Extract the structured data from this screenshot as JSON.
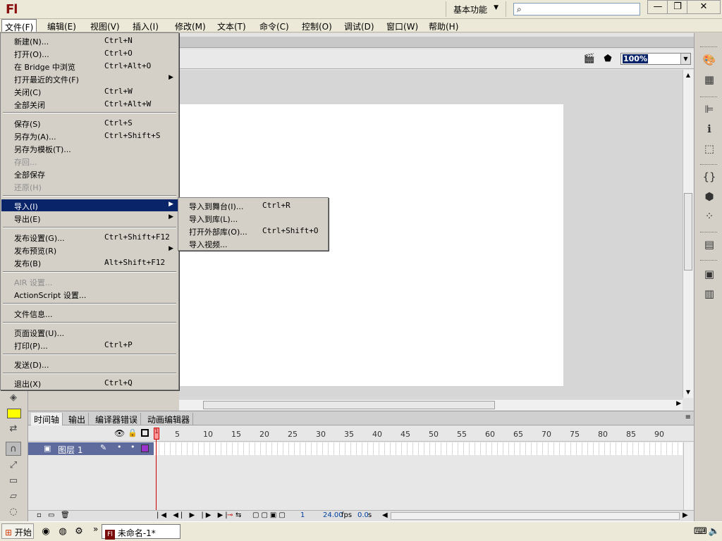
{
  "app": {
    "logo": "Fl",
    "workspace_label": "基本功能",
    "search_placeholder": "",
    "window_buttons": {
      "minimize": "—",
      "restore": "❐",
      "close": "✕"
    }
  },
  "menubar": {
    "items": [
      "文件(F)",
      "编辑(E)",
      "视图(V)",
      "插入(I)",
      "修改(M)",
      "文本(T)",
      "命令(C)",
      "控制(O)",
      "调试(D)",
      "窗口(W)",
      "帮助(H)"
    ]
  },
  "file_menu": {
    "items": [
      {
        "label": "新建(N)...",
        "shortcut": "Ctrl+N"
      },
      {
        "label": "打开(O)...",
        "shortcut": "Ctrl+O"
      },
      {
        "label": "在 Bridge 中浏览",
        "shortcut": "Ctrl+Alt+O"
      },
      {
        "label": "打开最近的文件(F)",
        "shortcut": ""
      },
      {
        "label": "关闭(C)",
        "shortcut": "Ctrl+W"
      },
      {
        "label": "全部关闭",
        "shortcut": "Ctrl+Alt+W"
      },
      {
        "label": "保存(S)",
        "shortcut": "Ctrl+S"
      },
      {
        "label": "另存为(A)...",
        "shortcut": "Ctrl+Shift+S"
      },
      {
        "label": "另存为模板(T)...",
        "shortcut": ""
      },
      {
        "label": "存回...",
        "shortcut": ""
      },
      {
        "label": "全部保存",
        "shortcut": ""
      },
      {
        "label": "还原(H)",
        "shortcut": ""
      },
      {
        "label": "导入(I)",
        "shortcut": ""
      },
      {
        "label": "导出(E)",
        "shortcut": ""
      },
      {
        "label": "发布设置(G)...",
        "shortcut": "Ctrl+Shift+F12"
      },
      {
        "label": "发布预览(R)",
        "shortcut": ""
      },
      {
        "label": "发布(B)",
        "shortcut": "Alt+Shift+F12"
      },
      {
        "label": "AIR 设置...",
        "shortcut": ""
      },
      {
        "label": "ActionScript 设置...",
        "shortcut": ""
      },
      {
        "label": "文件信息...",
        "shortcut": ""
      },
      {
        "label": "页面设置(U)...",
        "shortcut": ""
      },
      {
        "label": "打印(P)...",
        "shortcut": "Ctrl+P"
      },
      {
        "label": "发送(D)...",
        "shortcut": ""
      },
      {
        "label": "退出(X)",
        "shortcut": "Ctrl+Q"
      }
    ]
  },
  "import_submenu": {
    "items": [
      {
        "label": "导入到舞台(I)...",
        "shortcut": "Ctrl+R"
      },
      {
        "label": "导入到库(L)...",
        "shortcut": ""
      },
      {
        "label": "打开外部库(O)...",
        "shortcut": "Ctrl+Shift+O"
      },
      {
        "label": "导入视频...",
        "shortcut": ""
      }
    ]
  },
  "edit_bar": {
    "zoom": "100%"
  },
  "timeline": {
    "tabs": [
      "时间轴",
      "输出",
      "编译器错误",
      "动画编辑器"
    ],
    "frame_numbers": [
      "1",
      "5",
      "10",
      "15",
      "20",
      "25",
      "30",
      "35",
      "40",
      "45",
      "50",
      "55",
      "60",
      "65",
      "70",
      "75",
      "80",
      "85",
      "90"
    ],
    "layer_name": "图层 1",
    "current_frame": "1",
    "fps": "24.00",
    "fps_unit": "fps",
    "time": "0.0",
    "time_unit": "s"
  },
  "taskbar": {
    "start_label": "开始",
    "task_label": "未命名-1*",
    "more": "»"
  },
  "colors": {
    "fill_color": "#ffff00",
    "accent": "#0a246a",
    "layer_highlight": "#5e6b9c"
  }
}
